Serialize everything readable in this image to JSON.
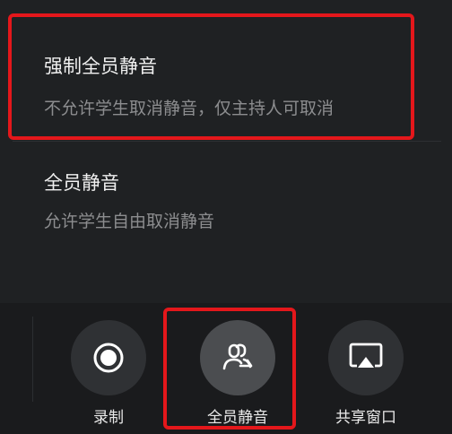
{
  "mute_menu": {
    "force_mute": {
      "title": "强制全员静音",
      "description": "不允许学生取消静音，仅主持人可取消"
    },
    "mute_all": {
      "title": "全员静音",
      "description": "允许学生自由取消静音"
    }
  },
  "toolbar": {
    "record": {
      "label": "录制",
      "icon": "record-icon"
    },
    "mute_all": {
      "label": "全员静音",
      "icon": "mute-all-icon"
    },
    "share_window": {
      "label": "共享窗口",
      "icon": "screen-share-icon"
    }
  },
  "colors": {
    "background": "#1f2123",
    "toolbar_background": "#1a1b1d",
    "highlight": "#e4171b",
    "text_primary": "#f1f1f1",
    "text_secondary": "#8c8d8f"
  }
}
